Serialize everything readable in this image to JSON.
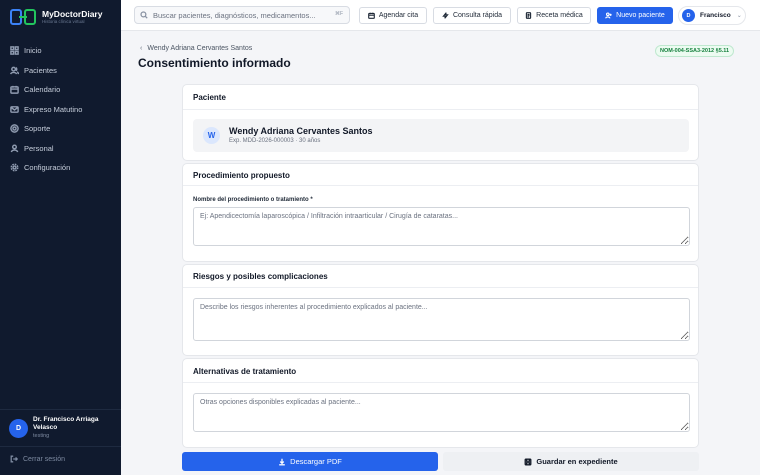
{
  "brand": {
    "name": "MyDoctorDiary",
    "tagline": "Historia clínica virtual"
  },
  "sidebar": {
    "items": [
      {
        "label": "Inicio",
        "icon": "grid-icon"
      },
      {
        "label": "Pacientes",
        "icon": "users-icon"
      },
      {
        "label": "Calendario",
        "icon": "calendar-icon"
      },
      {
        "label": "Expreso Matutino",
        "icon": "mail-icon"
      },
      {
        "label": "Soporte",
        "icon": "lifebuoy-icon"
      },
      {
        "label": "Personal",
        "icon": "user-icon"
      },
      {
        "label": "Configuración",
        "icon": "gear-icon"
      }
    ],
    "user": {
      "initial": "D",
      "name": "Dr. Francisco Arriaga Velasco",
      "role": "testing"
    },
    "logout_label": "Cerrar sesión"
  },
  "topbar": {
    "search_placeholder": "Buscar pacientes, diagnósticos, medicamentos...",
    "search_shortcut": "⌘F",
    "agendar_label": "Agendar cita",
    "consulta_label": "Consulta rápida",
    "receta_label": "Receta médica",
    "nuevo_label": "Nuevo paciente",
    "user_initial": "D",
    "user_name": "Francisco"
  },
  "header": {
    "breadcrumb": "Wendy Adriana Cervantes Santos",
    "title": "Consentimiento informado",
    "badge": "NOM-004-SSA3-2012 §5.11"
  },
  "paciente": {
    "section_title": "Paciente",
    "initial": "W",
    "name": "Wendy Adriana Cervantes Santos",
    "meta": "Exp. MDD-2026-000003 · 30 años"
  },
  "procedimiento": {
    "section_title": "Procedimiento propuesto",
    "field_label": "Nombre del procedimiento o tratamiento *",
    "placeholder": "Ej: Apendicectomía laparoscópica / Infiltración intraarticular / Cirugía de cataratas..."
  },
  "riesgos": {
    "section_title": "Riesgos y posibles complicaciones",
    "placeholder": "Describe los riesgos inherentes al procedimiento explicados al paciente..."
  },
  "alternativas": {
    "section_title": "Alternativas de tratamiento",
    "placeholder": "Otras opciones disponibles explicadas al paciente..."
  },
  "actions": {
    "pdf_label": "Descargar PDF",
    "save_label": "Guardar en expediente"
  },
  "colors": {
    "sidebar_bg": "#101a2e",
    "primary": "#2563eb",
    "badge_green": "#15803d"
  }
}
